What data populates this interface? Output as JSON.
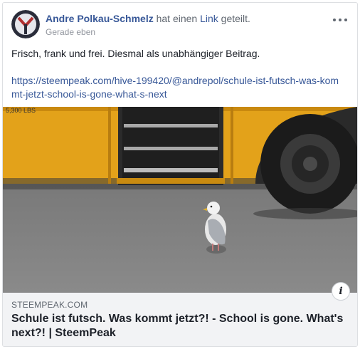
{
  "post": {
    "author": "Andre Polkau-Schmelz",
    "action_pre": " hat einen ",
    "action_link": "Link",
    "action_post": " geteilt.",
    "timestamp": "Gerade eben",
    "more_icon": "more-horizontal-icon",
    "text": "Frisch, frank und frei. Diesmal als unabhängiger Beitrag.",
    "url": "https://steempeak.com/hive-199420/@andrepol/schule-ist-futsch-was-kommt-jetzt-school-is-gone-what-s-next"
  },
  "link_preview": {
    "image_subject": "seagull standing in front of a yellow school bus",
    "bus_text": "5,300 LBS",
    "info_icon": "i",
    "domain": "STEEMPEAK.COM",
    "title": "Schule ist futsch. Was kommt jetzt?! - School is gone. What's next?! | SteemPeak"
  },
  "colors": {
    "link_blue": "#385898",
    "bus_yellow": "#e8a417",
    "caption_bg": "#f2f3f5"
  }
}
